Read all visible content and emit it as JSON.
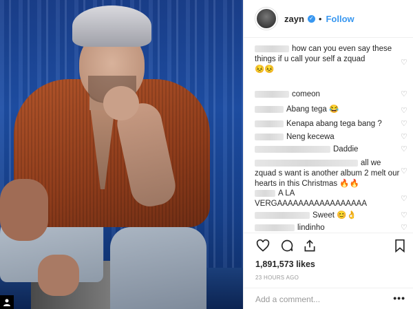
{
  "post": {
    "username": "zayn",
    "separator": "•",
    "follow_label": "Follow",
    "verified_icon": "verified-check-icon"
  },
  "comments": [
    {
      "text": "how can you even say these things if u call your self a zquad",
      "emoji": "😣😣"
    },
    {
      "text": "comeon",
      "emoji": ""
    },
    {
      "text": "Abang tega",
      "emoji": "😂"
    },
    {
      "text": "Kenapa abang tega bang ?",
      "emoji": ""
    },
    {
      "text": "Neng kecewa",
      "emoji": ""
    },
    {
      "text": "Daddie",
      "emoji": ""
    },
    {
      "text": "all we zquad s want is another album 2 melt our hearts in this Christmas",
      "emoji": "🔥🔥"
    },
    {
      "text": "A LA VERGAAAAAAAAAAAAAAAAA",
      "emoji": ""
    },
    {
      "text": "Sweet",
      "emoji": "😊👌"
    },
    {
      "text": "lindinho",
      "emoji": ""
    }
  ],
  "actions": {
    "like_icon": "heart-icon",
    "comment_icon": "comment-icon",
    "share_icon": "share-icon",
    "save_icon": "bookmark-icon"
  },
  "likes": "1,891,573 likes",
  "timestamp": "23 HOURS AGO",
  "add_comment": {
    "placeholder": "Add a comment...",
    "more_label": "•••"
  },
  "photo_badge": "user-tag-icon",
  "colors": {
    "accent": "#3897f0",
    "text": "#262626",
    "muted": "#999999",
    "photo_bg": "#1e4fa6",
    "jacket": "#a24a22"
  }
}
